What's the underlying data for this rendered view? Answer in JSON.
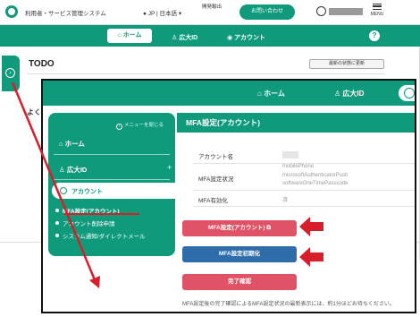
{
  "header": {
    "system_title": "利用者・サービス管理システム",
    "language": "JP | 日本語",
    "vendor": "開発輸出",
    "contact_button": "お問い合わせ",
    "menu_label": "MENU"
  },
  "top_nav": {
    "home": "ホーム",
    "koiki_id": "広大ID",
    "account": "アカウント"
  },
  "page": {
    "todo_title": "TODO",
    "refresh_button": "最新の状態に更新",
    "partial_heading": "よく"
  },
  "zoom_nav": {
    "home": "ホーム",
    "koiki_id": "広大ID"
  },
  "sidebar": {
    "close_menu": "メニューを閉じる",
    "home": "ホーム",
    "koiki_id": "広大ID",
    "account": "アカウント",
    "sub_items": [
      "MFA設定(アカウント)",
      "アカウント削除申請",
      "システム通知/ダイレクトメール"
    ]
  },
  "mfa_panel": {
    "title": "MFA設定(アカウント)",
    "account_name_label": "アカウント名",
    "mfa_status_label": "MFA設定状況",
    "mfa_status_values": [
      "mobilePhone",
      "microsoftAuthenticatorPush",
      "softwareOneTimePasscode"
    ],
    "mfa_enabled_label": "MFA有効化",
    "mfa_enabled_value": "済",
    "mfa_settings_button": "MFA設定(アカウント)",
    "mfa_reset_button": "MFA設定初期化",
    "completion_button": "完了確認",
    "footer_note": "MFA設定後の完了確認によるMFA設定状況の最新表示には、約1分ほどお待ちください。"
  },
  "colors": {
    "primary_green": "#0f9a7c",
    "pink_button": "#e05367",
    "blue_button": "#2f6daa",
    "annotation_red": "#d81e2a"
  }
}
